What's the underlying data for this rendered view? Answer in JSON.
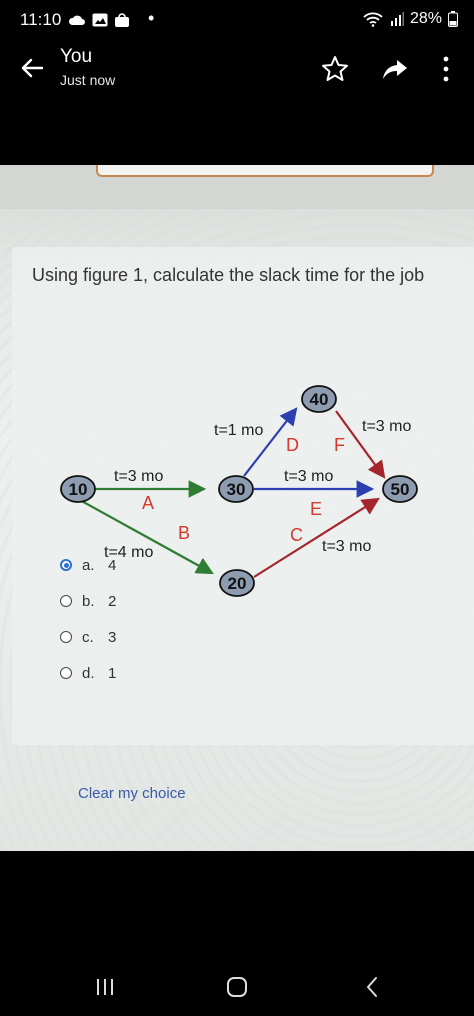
{
  "status_bar": {
    "time": "11:10",
    "battery": "28%"
  },
  "header": {
    "sender": "You",
    "timestamp": "Just now",
    "icons": [
      "back-arrow-icon",
      "star-icon",
      "share-icon",
      "more-vert-icon"
    ]
  },
  "question": {
    "text": "Using figure 1, calculate the slack time for the job"
  },
  "diagram": {
    "nodes": [
      "10",
      "30",
      "40",
      "50",
      "20"
    ],
    "activities": [
      {
        "letter": "A",
        "duration": "t=3 mo"
      },
      {
        "letter": "B",
        "duration": "t=4 mo"
      },
      {
        "letter": "C",
        "duration": "t=3 mo"
      },
      {
        "letter": "D",
        "duration": "t=1 mo"
      },
      {
        "letter": "E",
        "duration": "t=3 mo"
      },
      {
        "letter": "F",
        "duration": "t=3 mo"
      }
    ],
    "colors": {
      "green": "#2f7d32",
      "blue": "#2b3fb0",
      "red": "#a4262c"
    }
  },
  "options": [
    {
      "letter": "a.",
      "value": "4",
      "selected": true
    },
    {
      "letter": "b.",
      "value": "2",
      "selected": false
    },
    {
      "letter": "c.",
      "value": "3",
      "selected": false
    },
    {
      "letter": "d.",
      "value": "1",
      "selected": false
    }
  ],
  "clear_label": "Clear my choice"
}
